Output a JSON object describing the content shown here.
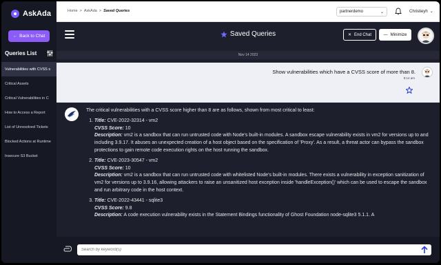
{
  "sidebar": {
    "brand": "AskAda",
    "back_label": "Back to Chat",
    "queries_title": "Queries List",
    "items": [
      {
        "label": "Vulnerabilities with CVSS s"
      },
      {
        "label": "Critical Assets"
      },
      {
        "label": "Critical Vulnerabilities in C"
      },
      {
        "label": "How to Access a Report"
      },
      {
        "label": "List of Unresolved Tickets"
      },
      {
        "label": "Blocked Actions at Runtime"
      },
      {
        "label": "Insecure S3 Bucket"
      }
    ]
  },
  "topbar": {
    "crumb_home": "Home",
    "crumb_sep": ">",
    "crumb_app": "AskAda",
    "crumb_current": "Saved Queries",
    "workspace": "partnerdemo",
    "user_name": "Christieyh"
  },
  "header": {
    "title": "Saved Queries",
    "end_chat_label": "End Chat",
    "minimize_label": "Minimize"
  },
  "chat": {
    "date": "Nov 14 2023",
    "user_message": "Show vulnerabilities which have a CVSS score of more than 8.",
    "user_time": "9:14 am",
    "bot_intro": "The critical vulnerabilities with a CVSS score higher than 8 are as follows, shown from most critical to least:",
    "labels": {
      "title": "Title:",
      "score": "CVSS Score:",
      "desc": "Description:"
    },
    "items": [
      {
        "title": "CVE-2022-32314 - vm2",
        "score": "10",
        "description": "vm2 is a sandbox that can run untrusted code with Node's built-in modules. A sandbox escape vulnerability exists in vm2 for versions up to and including 3.9.17. It abuses an unexpected creation of a host object based on the specification of 'Proxy'. As a result, a threat actor can bypass the sandbox protections to gain remote code execution rights on the host running the sandbox."
      },
      {
        "title": "CVE-2023-30547 - vm2",
        "score": "10",
        "description": "vm2 is a sandbox that can run untrusted code with whitelisted Node's built-in modules. There exists a vulnerability in exception sanitization of vm2 for versions up to 3.9.16, allowing attackers to raise an unsanitized host exception inside 'handleException()' which can be used to escape the sandbox and run arbitrary code in the host context."
      },
      {
        "title": "CVE-2022-43441 - sqlite3",
        "score": "9.8",
        "description": "A code execution vulnerability exists in the Statement Bindings functionality of Ghost Foundation node-sqlite3 5.1.1. A"
      }
    ]
  },
  "input": {
    "placeholder": "Search by keyword(s)"
  },
  "colors": {
    "accent": "#8b5cf6",
    "background": "#1d1f2c",
    "sidebar": "#161824"
  }
}
